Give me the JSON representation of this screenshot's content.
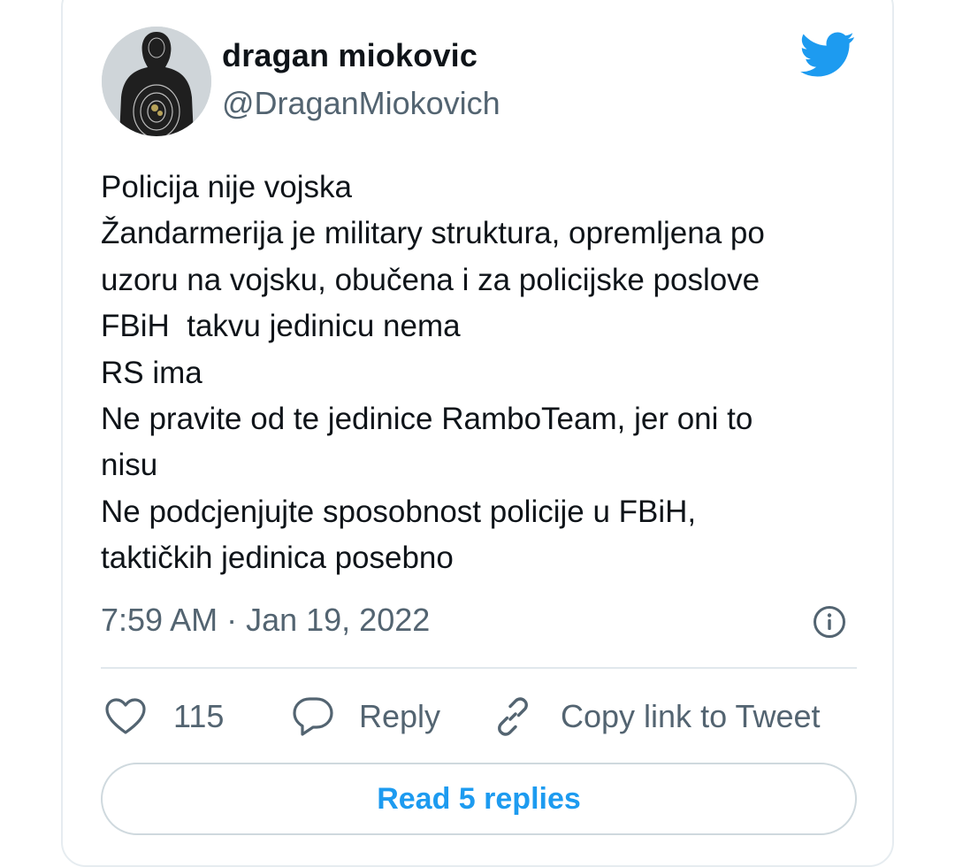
{
  "author": {
    "name": "dragan miokovic",
    "handle": "@DraganMiokovich"
  },
  "tweet": {
    "lines": [
      "Policija nije vojska",
      "Žandarmerija je military struktura, opremljena po",
      "uzoru na vojsku, obučena i za policijske poslove",
      "FBiH  takvu jedinicu nema",
      "RS ima",
      "Ne pravite od te jedinice RamboTeam, jer oni to",
      "nisu",
      "Ne podcjenjujte sposobnost policije u FBiH,",
      "taktičkih jedinica posebno"
    ],
    "timestamp": "7:59 AM · Jan 19, 2022"
  },
  "actions": {
    "like_count": "115",
    "reply_label": "Reply",
    "copy_link_label": "Copy link to Tweet"
  },
  "read_replies_label": "Read 5 replies",
  "icons": {
    "twitter": "twitter-bird-icon",
    "info": "info-icon",
    "like": "heart-icon",
    "reply": "speech-bubble-icon",
    "copy": "link-icon"
  },
  "colors": {
    "brand": "#1d9bf0",
    "text": "#0f1419",
    "secondary": "#536471",
    "border": "#e1e8ed"
  }
}
